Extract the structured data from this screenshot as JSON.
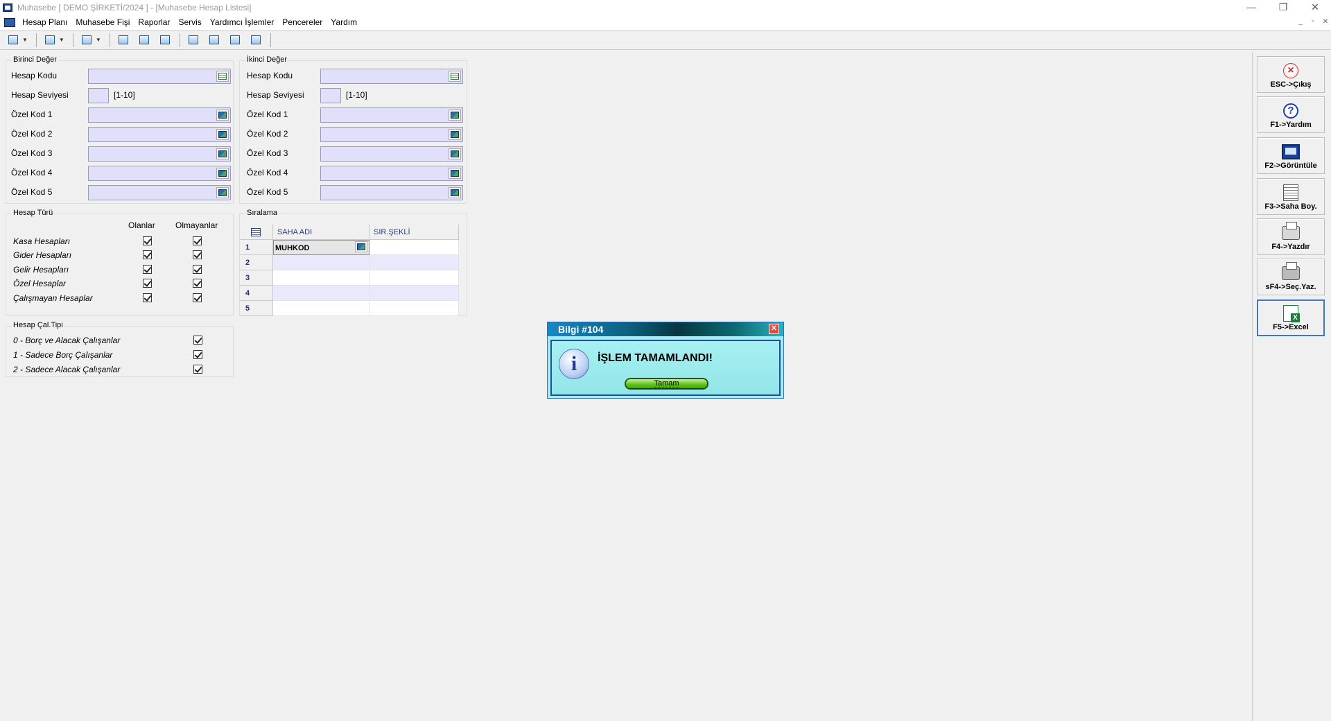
{
  "window": {
    "title": "Muhasebe [ DEMO ŞİRKETİ/2024 ]  - [Muhasebe Hesap Listesi]",
    "controls": [
      "—",
      "❐",
      "✕"
    ],
    "mdi_controls": [
      "_",
      "▫",
      "✕"
    ]
  },
  "menu": {
    "items": [
      "Hesap Planı",
      "Muhasebe Fişi",
      "Raporlar",
      "Servis",
      "Yardımcı İşlemler",
      "Pencereler",
      "Yardım"
    ]
  },
  "birinci": {
    "title": "Birinci Değer",
    "hesap_kodu_label": "Hesap Kodu",
    "hesap_seviyesi_label": "Hesap Seviyesi",
    "range_hint": "[1-10]",
    "ozel_kodlar": [
      "Özel Kod 1",
      "Özel Kod 2",
      "Özel Kod 3",
      "Özel Kod 4",
      "Özel Kod 5"
    ]
  },
  "ikinci": {
    "title": "İkinci Değer",
    "hesap_kodu_label": "Hesap Kodu",
    "hesap_seviyesi_label": "Hesap Seviyesi",
    "range_hint": "[1-10]",
    "ozel_kodlar": [
      "Özel Kod 1",
      "Özel Kod 2",
      "Özel Kod 3",
      "Özel Kod 4",
      "Özel Kod 5"
    ]
  },
  "hesap_turu": {
    "title": "Hesap Türü",
    "col_olanlar": "Olanlar",
    "col_olmayanlar": "Olmayanlar",
    "rows": [
      "Kasa Hesapları",
      "Gider Hesapları",
      "Gelir Hesapları",
      "Özel Hesaplar",
      "Çalışmayan Hesaplar"
    ]
  },
  "hesap_cal": {
    "title": "Hesap Çal.Tipi",
    "rows": [
      "0 - Borç ve Alacak Çalışanlar",
      "1 - Sadece Borç Çalışanlar",
      "2 - Sadece Alacak Çalışanlar"
    ]
  },
  "siralama": {
    "title": "Sıralama",
    "col_saha": "SAHA ADI",
    "col_sir": "SIR.ŞEKLİ",
    "rows": [
      {
        "num": "1",
        "saha": "MUHKOD",
        "sir": ""
      },
      {
        "num": "2",
        "saha": "",
        "sir": ""
      },
      {
        "num": "3",
        "saha": "",
        "sir": ""
      },
      {
        "num": "4",
        "saha": "",
        "sir": ""
      },
      {
        "num": "5",
        "saha": "",
        "sir": ""
      }
    ]
  },
  "side_buttons": [
    {
      "label": "ESC->Çıkış",
      "icon": "exit-icon"
    },
    {
      "label": "F1->Yardım",
      "icon": "help-icon"
    },
    {
      "label": "F2->Görüntüle",
      "icon": "monitor-icon"
    },
    {
      "label": "F3->Saha Boy.",
      "icon": "document-icon"
    },
    {
      "label": "F4->Yazdır",
      "icon": "printer-icon"
    },
    {
      "label": "sF4->Seç.Yaz.",
      "icon": "printer-select-icon"
    },
    {
      "label": "F5->Excel",
      "icon": "excel-icon"
    }
  ],
  "dialog": {
    "title": "Bilgi #104",
    "message": "İŞLEM TAMAMLANDI!",
    "ok_label": "Tamam",
    "close_glyph": "✕"
  }
}
